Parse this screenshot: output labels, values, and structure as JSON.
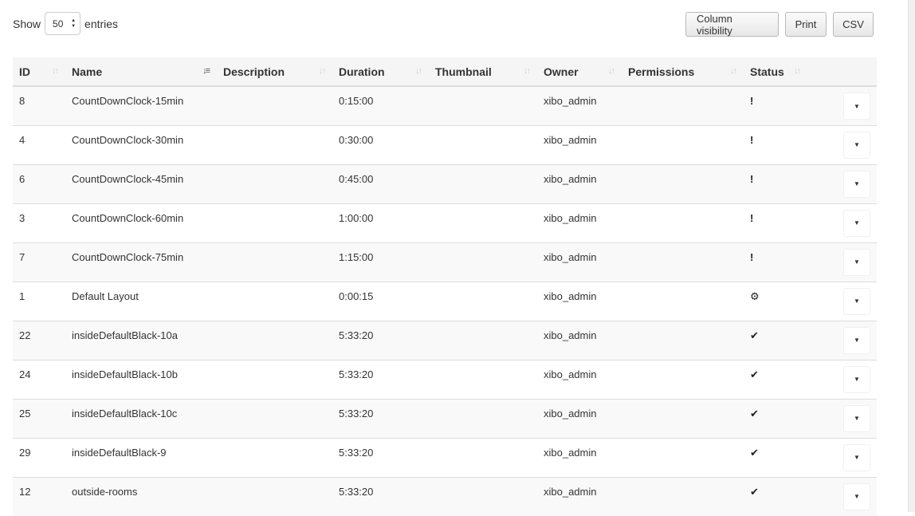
{
  "length_control": {
    "show_label": "Show",
    "value": "50",
    "entries_label": "entries"
  },
  "buttons": {
    "column_visibility": "Column visibility",
    "print": "Print",
    "csv": "CSV"
  },
  "table": {
    "columns": [
      "ID",
      "Name",
      "Description",
      "Duration",
      "Thumbnail",
      "Owner",
      "Permissions",
      "Status",
      ""
    ],
    "sorted_column": "Name",
    "rows": [
      {
        "id": "8",
        "name": "CountDownClock-15min",
        "description": "",
        "duration": "0:15:00",
        "thumbnail": "",
        "owner": "xibo_admin",
        "permissions": "",
        "status_icon": "exclamation-icon",
        "status_glyph": "!"
      },
      {
        "id": "4",
        "name": "CountDownClock-30min",
        "description": "",
        "duration": "0:30:00",
        "thumbnail": "",
        "owner": "xibo_admin",
        "permissions": "",
        "status_icon": "exclamation-icon",
        "status_glyph": "!"
      },
      {
        "id": "6",
        "name": "CountDownClock-45min",
        "description": "",
        "duration": "0:45:00",
        "thumbnail": "",
        "owner": "xibo_admin",
        "permissions": "",
        "status_icon": "exclamation-icon",
        "status_glyph": "!"
      },
      {
        "id": "3",
        "name": "CountDownClock-60min",
        "description": "",
        "duration": "1:00:00",
        "thumbnail": "",
        "owner": "xibo_admin",
        "permissions": "",
        "status_icon": "exclamation-icon",
        "status_glyph": "!"
      },
      {
        "id": "7",
        "name": "CountDownClock-75min",
        "description": "",
        "duration": "1:15:00",
        "thumbnail": "",
        "owner": "xibo_admin",
        "permissions": "",
        "status_icon": "exclamation-icon",
        "status_glyph": "!"
      },
      {
        "id": "1",
        "name": "Default Layout",
        "description": "",
        "duration": "0:00:15",
        "thumbnail": "",
        "owner": "xibo_admin",
        "permissions": "",
        "status_icon": "cogs-icon",
        "status_glyph": "⚙"
      },
      {
        "id": "22",
        "name": "insideDefaultBlack-10a",
        "description": "",
        "duration": "5:33:20",
        "thumbnail": "",
        "owner": "xibo_admin",
        "permissions": "",
        "status_icon": "check-icon",
        "status_glyph": "✔"
      },
      {
        "id": "24",
        "name": "insideDefaultBlack-10b",
        "description": "",
        "duration": "5:33:20",
        "thumbnail": "",
        "owner": "xibo_admin",
        "permissions": "",
        "status_icon": "check-icon",
        "status_glyph": "✔"
      },
      {
        "id": "25",
        "name": "insideDefaultBlack-10c",
        "description": "",
        "duration": "5:33:20",
        "thumbnail": "",
        "owner": "xibo_admin",
        "permissions": "",
        "status_icon": "check-icon",
        "status_glyph": "✔"
      },
      {
        "id": "29",
        "name": "insideDefaultBlack-9",
        "description": "",
        "duration": "5:33:20",
        "thumbnail": "",
        "owner": "xibo_admin",
        "permissions": "",
        "status_icon": "check-icon",
        "status_glyph": "✔"
      },
      {
        "id": "12",
        "name": "outside-rooms",
        "description": "",
        "duration": "5:33:20",
        "thumbnail": "",
        "owner": "xibo_admin",
        "permissions": "",
        "status_icon": "check-icon",
        "status_glyph": "✔"
      }
    ],
    "row_action_icon": "caret-down-icon"
  }
}
